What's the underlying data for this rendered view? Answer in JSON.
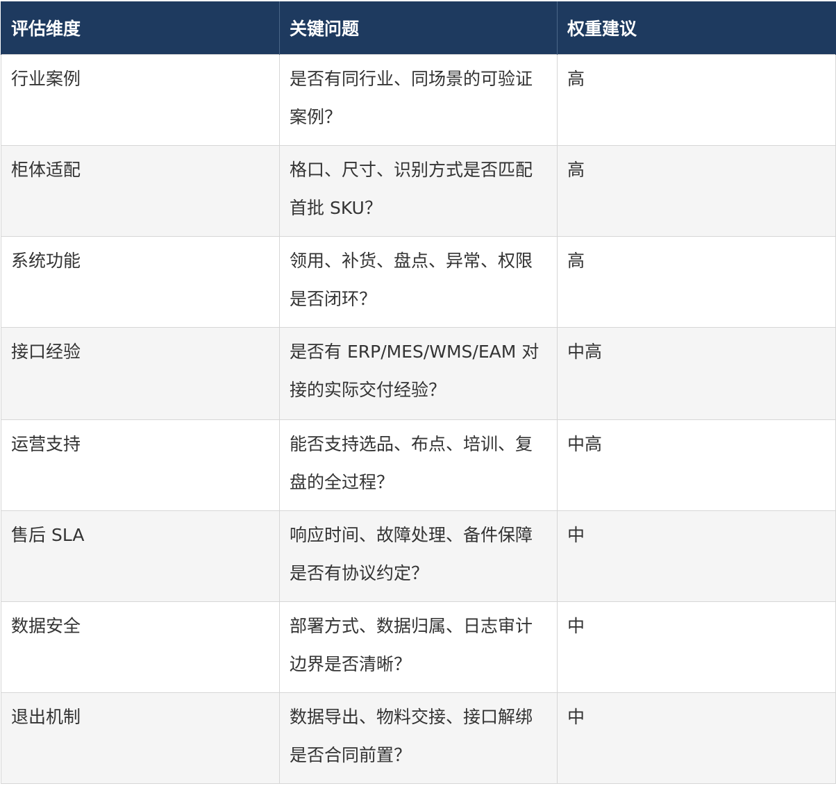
{
  "table": {
    "headers": [
      "评估维度",
      "关键问题",
      "权重建议"
    ],
    "rows": [
      {
        "dimension": "行业案例",
        "question": "是否有同行业、同场景的可验证案例？",
        "weight": "高"
      },
      {
        "dimension": "柜体适配",
        "question": "格口、尺寸、识别方式是否匹配首批 SKU？",
        "weight": "高"
      },
      {
        "dimension": "系统功能",
        "question": "领用、补货、盘点、异常、权限是否闭环？",
        "weight": "高"
      },
      {
        "dimension": "接口经验",
        "question": "是否有 ERP/MES/WMS/EAM 对接的实际交付经验？",
        "weight": "中高"
      },
      {
        "dimension": "运营支持",
        "question": "能否支持选品、布点、培训、复盘的全过程？",
        "weight": "中高"
      },
      {
        "dimension": "售后 SLA",
        "question": "响应时间、故障处理、备件保障是否有协议约定？",
        "weight": "中"
      },
      {
        "dimension": "数据安全",
        "question": "部署方式、数据归属、日志审计边界是否清晰？",
        "weight": "中"
      },
      {
        "dimension": "退出机制",
        "question": "数据导出、物料交接、接口解绑是否合同前置？",
        "weight": "中"
      }
    ]
  },
  "colors": {
    "header_bg": "#1e3a5f",
    "header_text": "#ffffff",
    "row_alt_bg": "#f5f5f5",
    "border": "#d6d6d6",
    "body_text": "#333333"
  }
}
